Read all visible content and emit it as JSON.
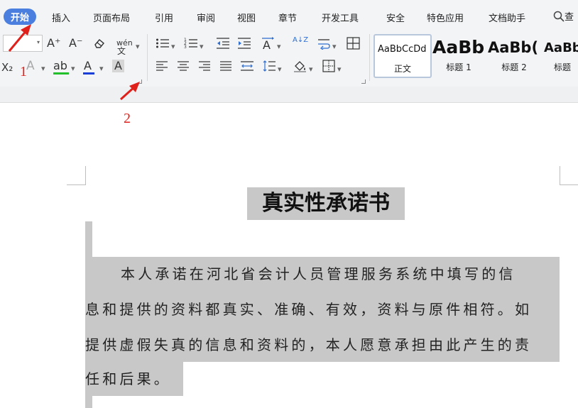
{
  "menu": {
    "tabs": [
      "开始",
      "插入",
      "页面布局",
      "引用",
      "审阅",
      "视图",
      "章节",
      "开发工具",
      "安全",
      "特色应用",
      "文档助手"
    ],
    "active_tab": "开始",
    "search_label": "查"
  },
  "ribbon": {
    "font_size_arrow": "▾",
    "grow_font": "A⁺",
    "shrink_font": "A⁻",
    "clear_format": "⌫",
    "pinyin": "wén",
    "subscript": "X₂",
    "text_effect": "A",
    "highlight": "ab",
    "font_color": "A",
    "char_shading": "A",
    "sort": "A↓Z",
    "styles": [
      {
        "sample": "AaBbCcDd",
        "name": "正文"
      },
      {
        "sample": "AaBb",
        "name": "标题 1"
      },
      {
        "sample": "AaBb(",
        "name": "标题 2"
      },
      {
        "sample": "AaBb",
        "name": "标题"
      }
    ]
  },
  "annotations": {
    "one": "1",
    "two": "2"
  },
  "document": {
    "title": "真实性承诺书",
    "lines": [
      "本人承诺在河北省会计人员管理服务系统中填写的信",
      "息和提供的资料都真实、准确、有效，资料与原件相符。如",
      "提供虚假失真的信息和资料的，本人愿意承担由此产生的责",
      "任和后果。"
    ]
  },
  "colors": {
    "accent": "#4a7fe0",
    "highlight_green": "#22c02a",
    "font_color_blue": "#1a3fd8",
    "annotation_red": "#e0201a",
    "selection_gray": "#c8c8c8"
  }
}
